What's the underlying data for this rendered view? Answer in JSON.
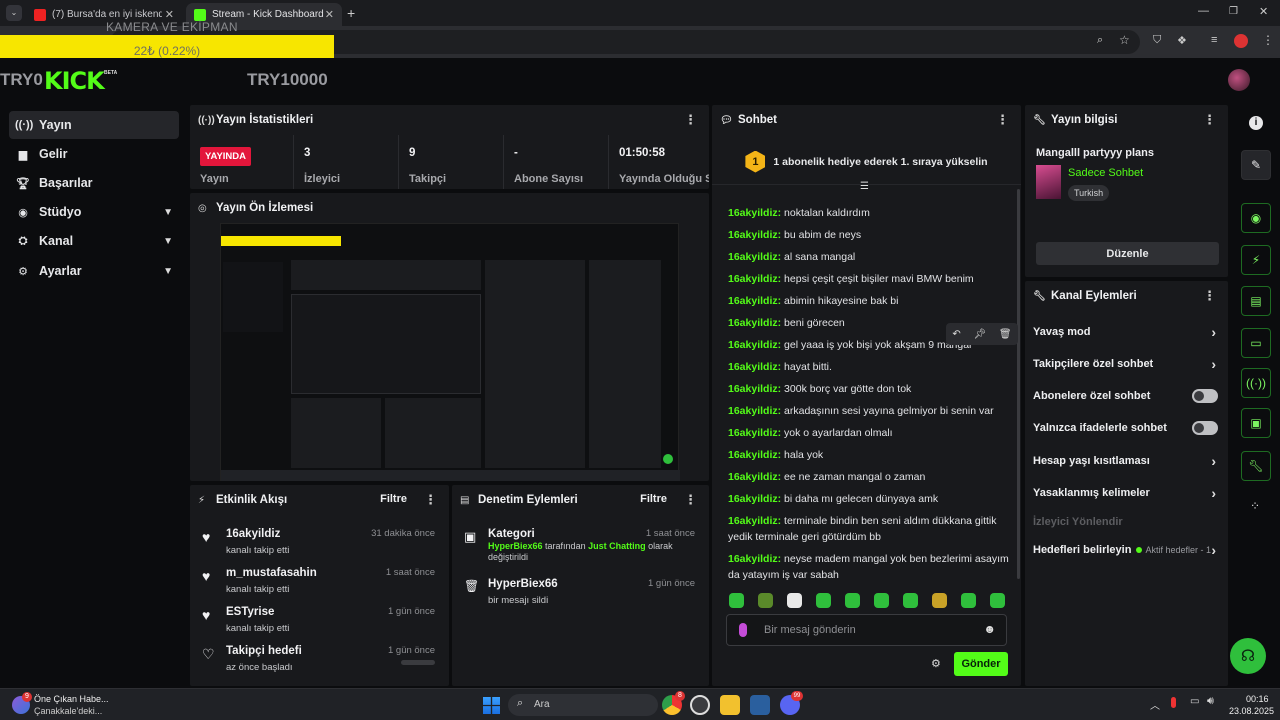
{
  "browser": {
    "tabs": [
      {
        "title": "(7) Bursa'da en iyi iskender burs"
      },
      {
        "title": "Stream - Kick Dashboard"
      }
    ]
  },
  "overlay": {
    "banner_text": "22₺ (0.22%)",
    "banner_caption": "KAMERA VE EKİPMAN",
    "left_text": "TRY0",
    "goal_text": "TRY10000"
  },
  "brand": {
    "logo": "KICK",
    "beta": "BETA",
    "accent": "#53fc18"
  },
  "sidebar": {
    "items": [
      {
        "label": "Yayın",
        "icon": "broadcast-icon"
      },
      {
        "label": "Gelir",
        "icon": "revenue-icon"
      },
      {
        "label": "Başarılar",
        "icon": "trophy-icon"
      },
      {
        "label": "Stüdyo",
        "icon": "studio-icon"
      },
      {
        "label": "Kanal",
        "icon": "channel-icon"
      },
      {
        "label": "Ayarlar",
        "icon": "gear-icon"
      }
    ]
  },
  "stats": {
    "title": "Yayın İstatistikleri",
    "live_badge": "YAYINDA",
    "items": [
      {
        "label": "Yayın",
        "value": ""
      },
      {
        "label": "İzleyici",
        "value": "3"
      },
      {
        "label": "Takipçi",
        "value": "9"
      },
      {
        "label": "Abone Sayısı",
        "value": "-"
      },
      {
        "label": "Yayında Olduğu Sü",
        "value": "01:50:58"
      }
    ]
  },
  "preview": {
    "title": "Yayın Ön İzlemesi"
  },
  "activity": {
    "title": "Etkinlik Akışı",
    "filter": "Filtre",
    "items": [
      {
        "name": "16akyildiz",
        "sub": "kanalı takip etti",
        "when": "31 dakika önce"
      },
      {
        "name": "m_mustafasahin",
        "sub": "kanalı takip etti",
        "when": "1 saat önce"
      },
      {
        "name": "ESTyrise",
        "sub": "kanalı takip etti",
        "when": "1 gün önce"
      },
      {
        "name": "Takipçi hedefi",
        "sub": "az önce başladı",
        "when": "1 gün önce"
      }
    ]
  },
  "moderation": {
    "title": "Denetim Eylemleri",
    "filter": "Filtre",
    "items": [
      {
        "name": "Kategori",
        "user": "HyperBiex66",
        "mid": " tarafından ",
        "target": "Just Chatting",
        "tail": " olarak değiştirildi",
        "when": "1 saat önce"
      },
      {
        "name": "HyperBiex66",
        "sub": "bir mesajı sildi",
        "when": "1 gün önce"
      }
    ]
  },
  "chat": {
    "title": "Sohbet",
    "pinned": "1 abonelik hediye ederek 1. sıraya yükselin",
    "pinned_rank": "1",
    "placeholder": "Bir mesaj gönderin",
    "send": "Gönder",
    "messages": [
      {
        "user": "16akyildiz",
        "text": "noktalan kaldırdım"
      },
      {
        "user": "16akyildiz",
        "text": "bu abim de neys"
      },
      {
        "user": "16akyildiz",
        "text": "al sana mangal"
      },
      {
        "user": "16akyildiz",
        "text": "hepsi çeşit çeşit bişiler mavi BMW benim"
      },
      {
        "user": "16akyildiz",
        "text": "abimin hikayesine bak bi"
      },
      {
        "user": "16akyildiz",
        "text": "beni görecen"
      },
      {
        "user": "16akyildiz",
        "text": "gel yaaa iş yok bişi yok akşam 9 mangal"
      },
      {
        "user": "16akyildiz",
        "text": "hayat bitti."
      },
      {
        "user": "16akyildiz",
        "text": "300k borç var götte don tok"
      },
      {
        "user": "16akyildiz",
        "text": "arkadaşının sesi yayına gelmiyor bi senin var"
      },
      {
        "user": "16akyildiz",
        "text": "yok o ayarlardan olmalı"
      },
      {
        "user": "16akyildiz",
        "text": "hala yok"
      },
      {
        "user": "16akyildiz",
        "text": "ee ne zaman mangal o zaman"
      },
      {
        "user": "16akyildiz",
        "text": "bi daha mı gelecen dünyaya amk"
      },
      {
        "user": "16akyildiz",
        "text": "terminale bindin ben seni aldım dükkana gittik yedik terminale geri götürdüm bb"
      },
      {
        "user": "16akyildiz",
        "text": "neyse madem mangal yok ben bezlerimi asayım da yatayım iş var sabah"
      }
    ]
  },
  "stream_info": {
    "title": "Yayın bilgisi",
    "stream_title": "Mangalll partyyy plans",
    "category": "Sadece Sohbet",
    "tag": "Turkish",
    "edit": "Düzenle"
  },
  "channel_actions": {
    "title": "Kanal Eylemleri",
    "rows": [
      {
        "label": "Yavaş mod",
        "kind": "chevron"
      },
      {
        "label": "Takipçilere özel sohbet",
        "kind": "chevron"
      },
      {
        "label": "Abonelere özel sohbet",
        "kind": "toggle"
      },
      {
        "label": "Yalnızca ifadelerle sohbet",
        "kind": "toggle"
      },
      {
        "label": "Hesap yaşı kısıtlaması",
        "kind": "chevron"
      },
      {
        "label": "Yasaklanmış kelimeler",
        "kind": "chevron"
      },
      {
        "label": "İzleyici Yönlendir",
        "kind": "disabled"
      },
      {
        "label": "Hedefleri belirleyin",
        "kind": "chevron",
        "extra": "Aktif hedefler - 1"
      }
    ]
  },
  "taskbar": {
    "news_title": "Öne Çıkan Habe...",
    "news_sub": "Çanakkale'deki...",
    "news_badge": "9",
    "search": "Ara",
    "time": "00:16",
    "date": "23.08.2025",
    "chrome_badge": "8",
    "discord_badge": "99"
  }
}
